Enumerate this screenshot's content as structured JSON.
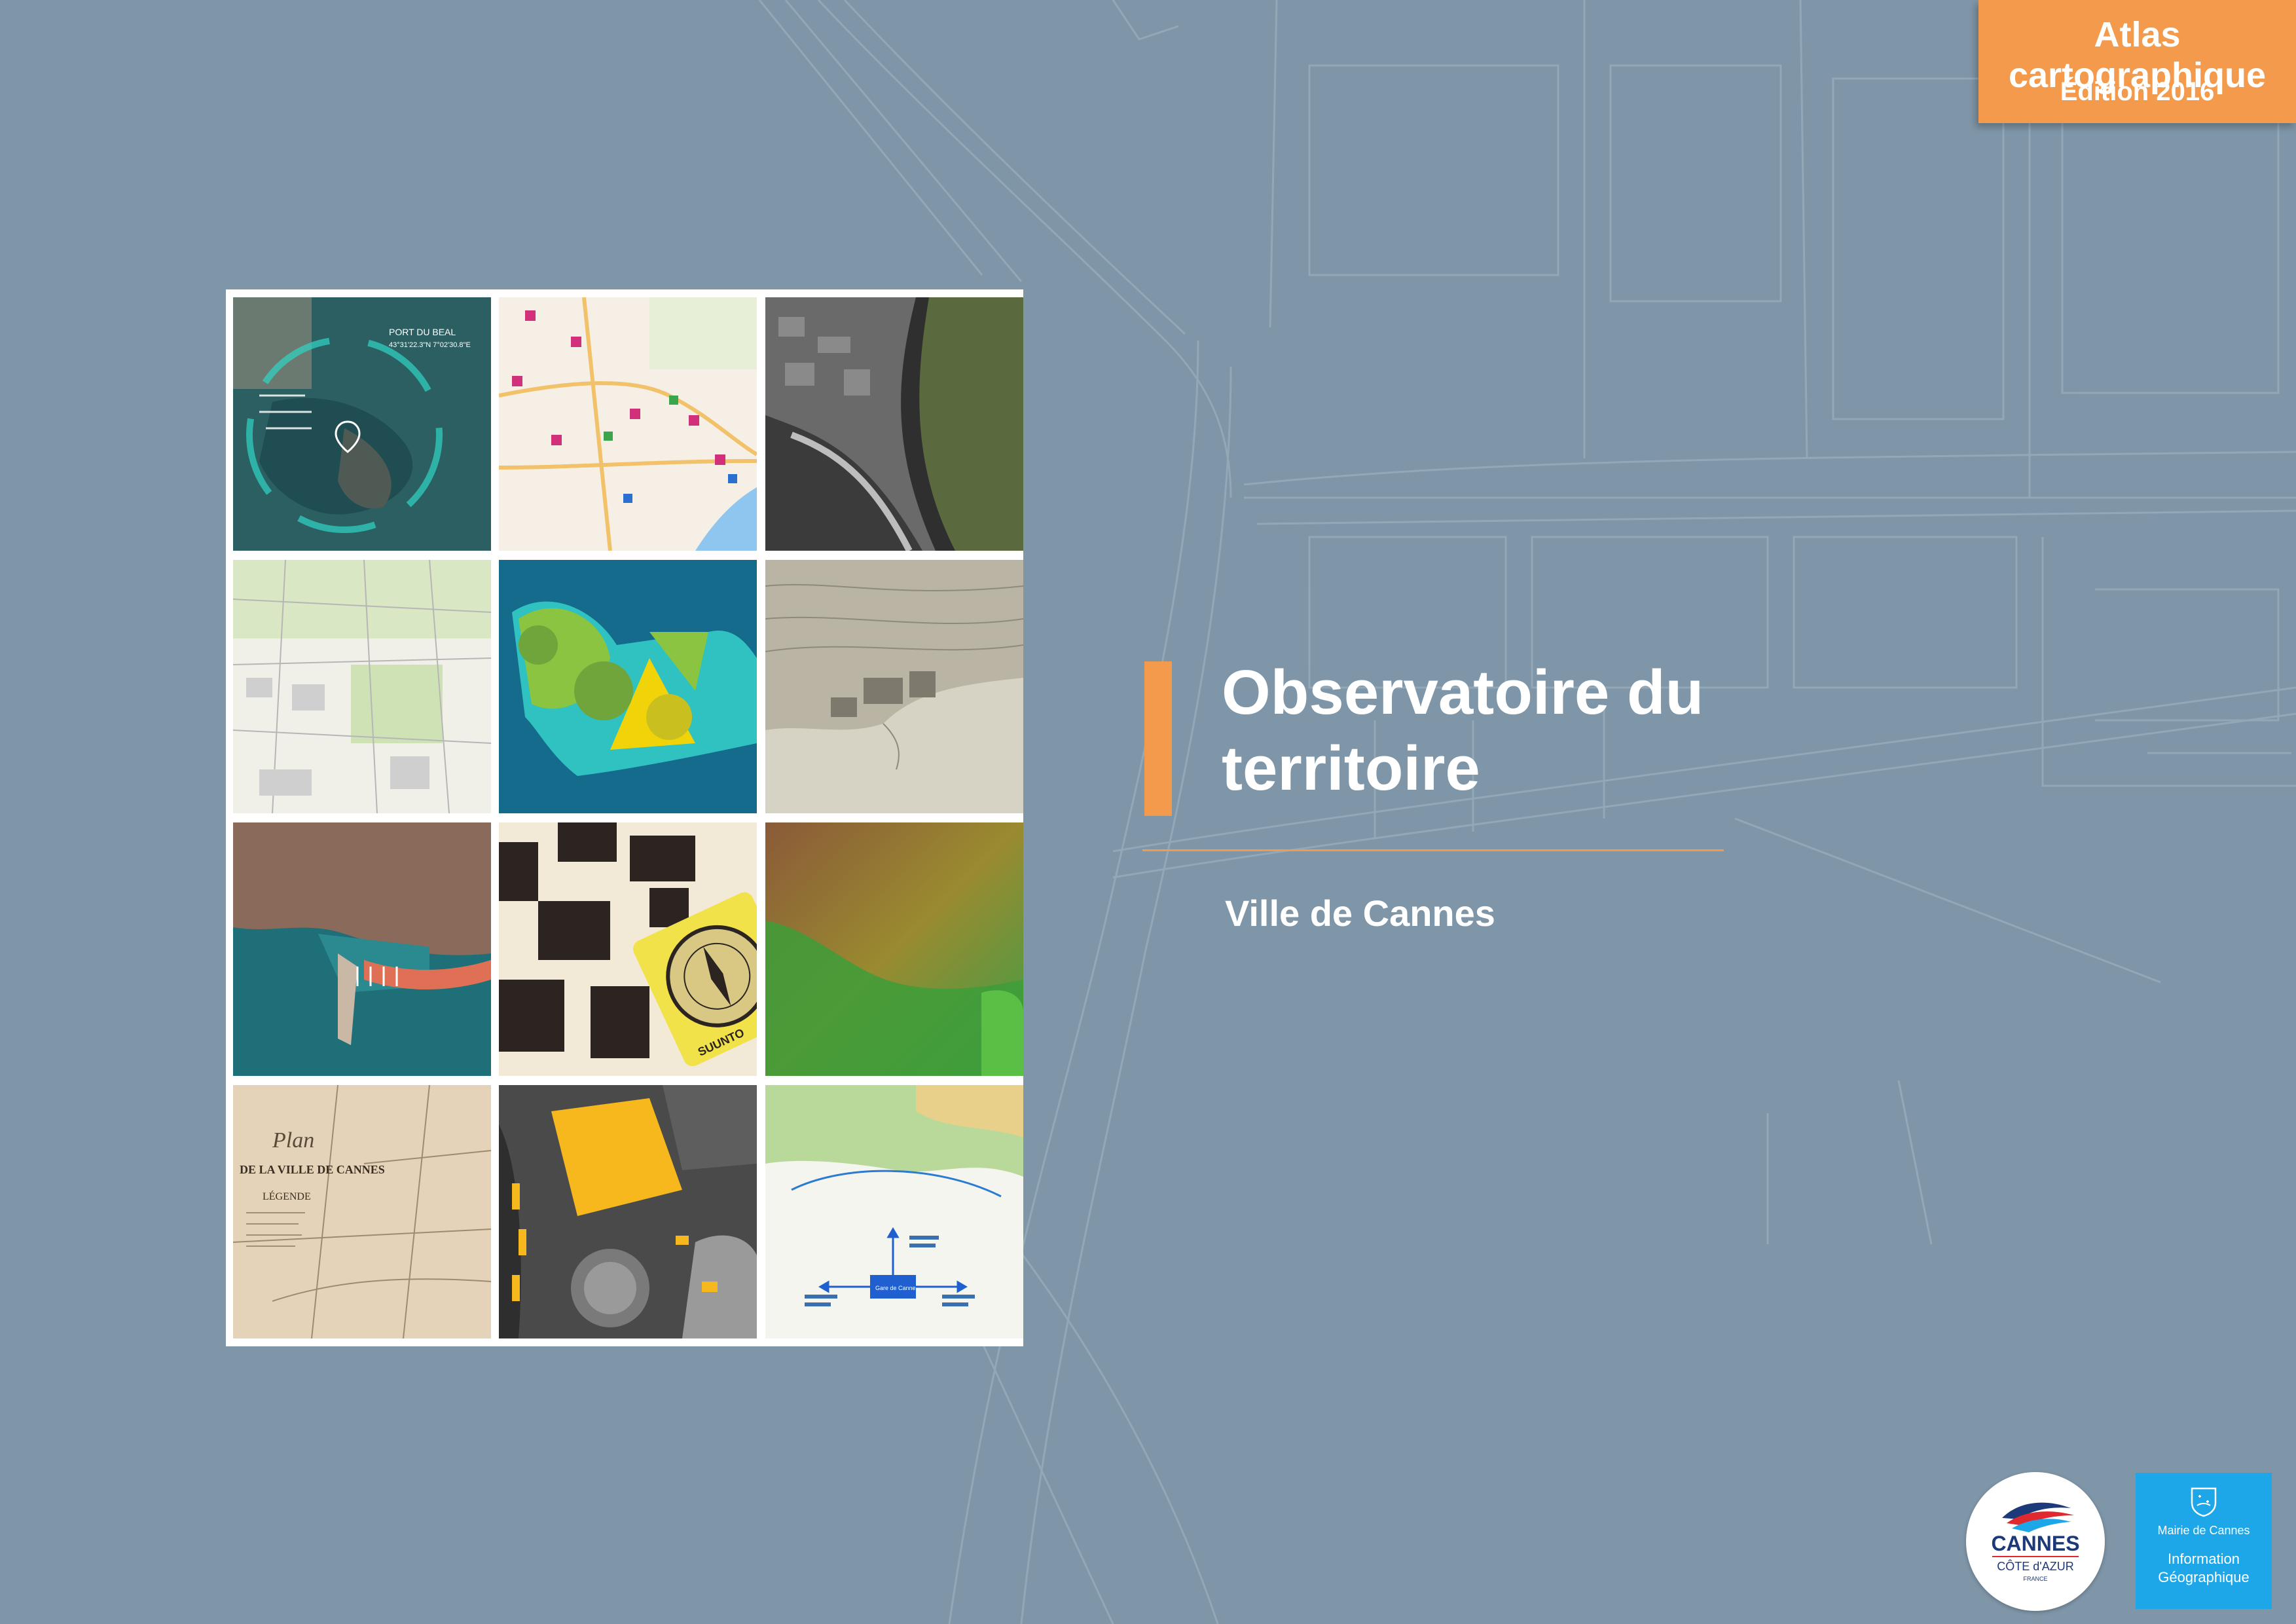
{
  "header": {
    "atlas_label": "Atlas cartographique",
    "edition_label": "Édition 2016"
  },
  "title": {
    "line1": "Observatoire du",
    "line2": "territoire",
    "subtitle": "Ville de Cannes"
  },
  "tiles": {
    "port_label": "PORT DU BEAL",
    "port_coords": "43°31'22.3\"N 7°02'30.8\"E",
    "legend_title": "LÉGENDE",
    "plan_title": "Plan",
    "plan_subtitle": "DE LA VILLE DE CANNES",
    "compass_brand": "SUUNTO",
    "station_label": "Gare de Cannes"
  },
  "logos": {
    "cannes_name": "CANNES",
    "cannes_region": "CÔTE d'AZUR",
    "cannes_country": "FRANCE",
    "mairie_name": "Mairie de Cannes",
    "service_line1": "Information",
    "service_line2": "Géographique"
  },
  "colors": {
    "background": "#7f96a8",
    "accent": "#f39a4c",
    "mairie_blue": "#1ea7e8",
    "cannes_navy": "#1c3a7a",
    "cannes_red": "#e0282f"
  }
}
